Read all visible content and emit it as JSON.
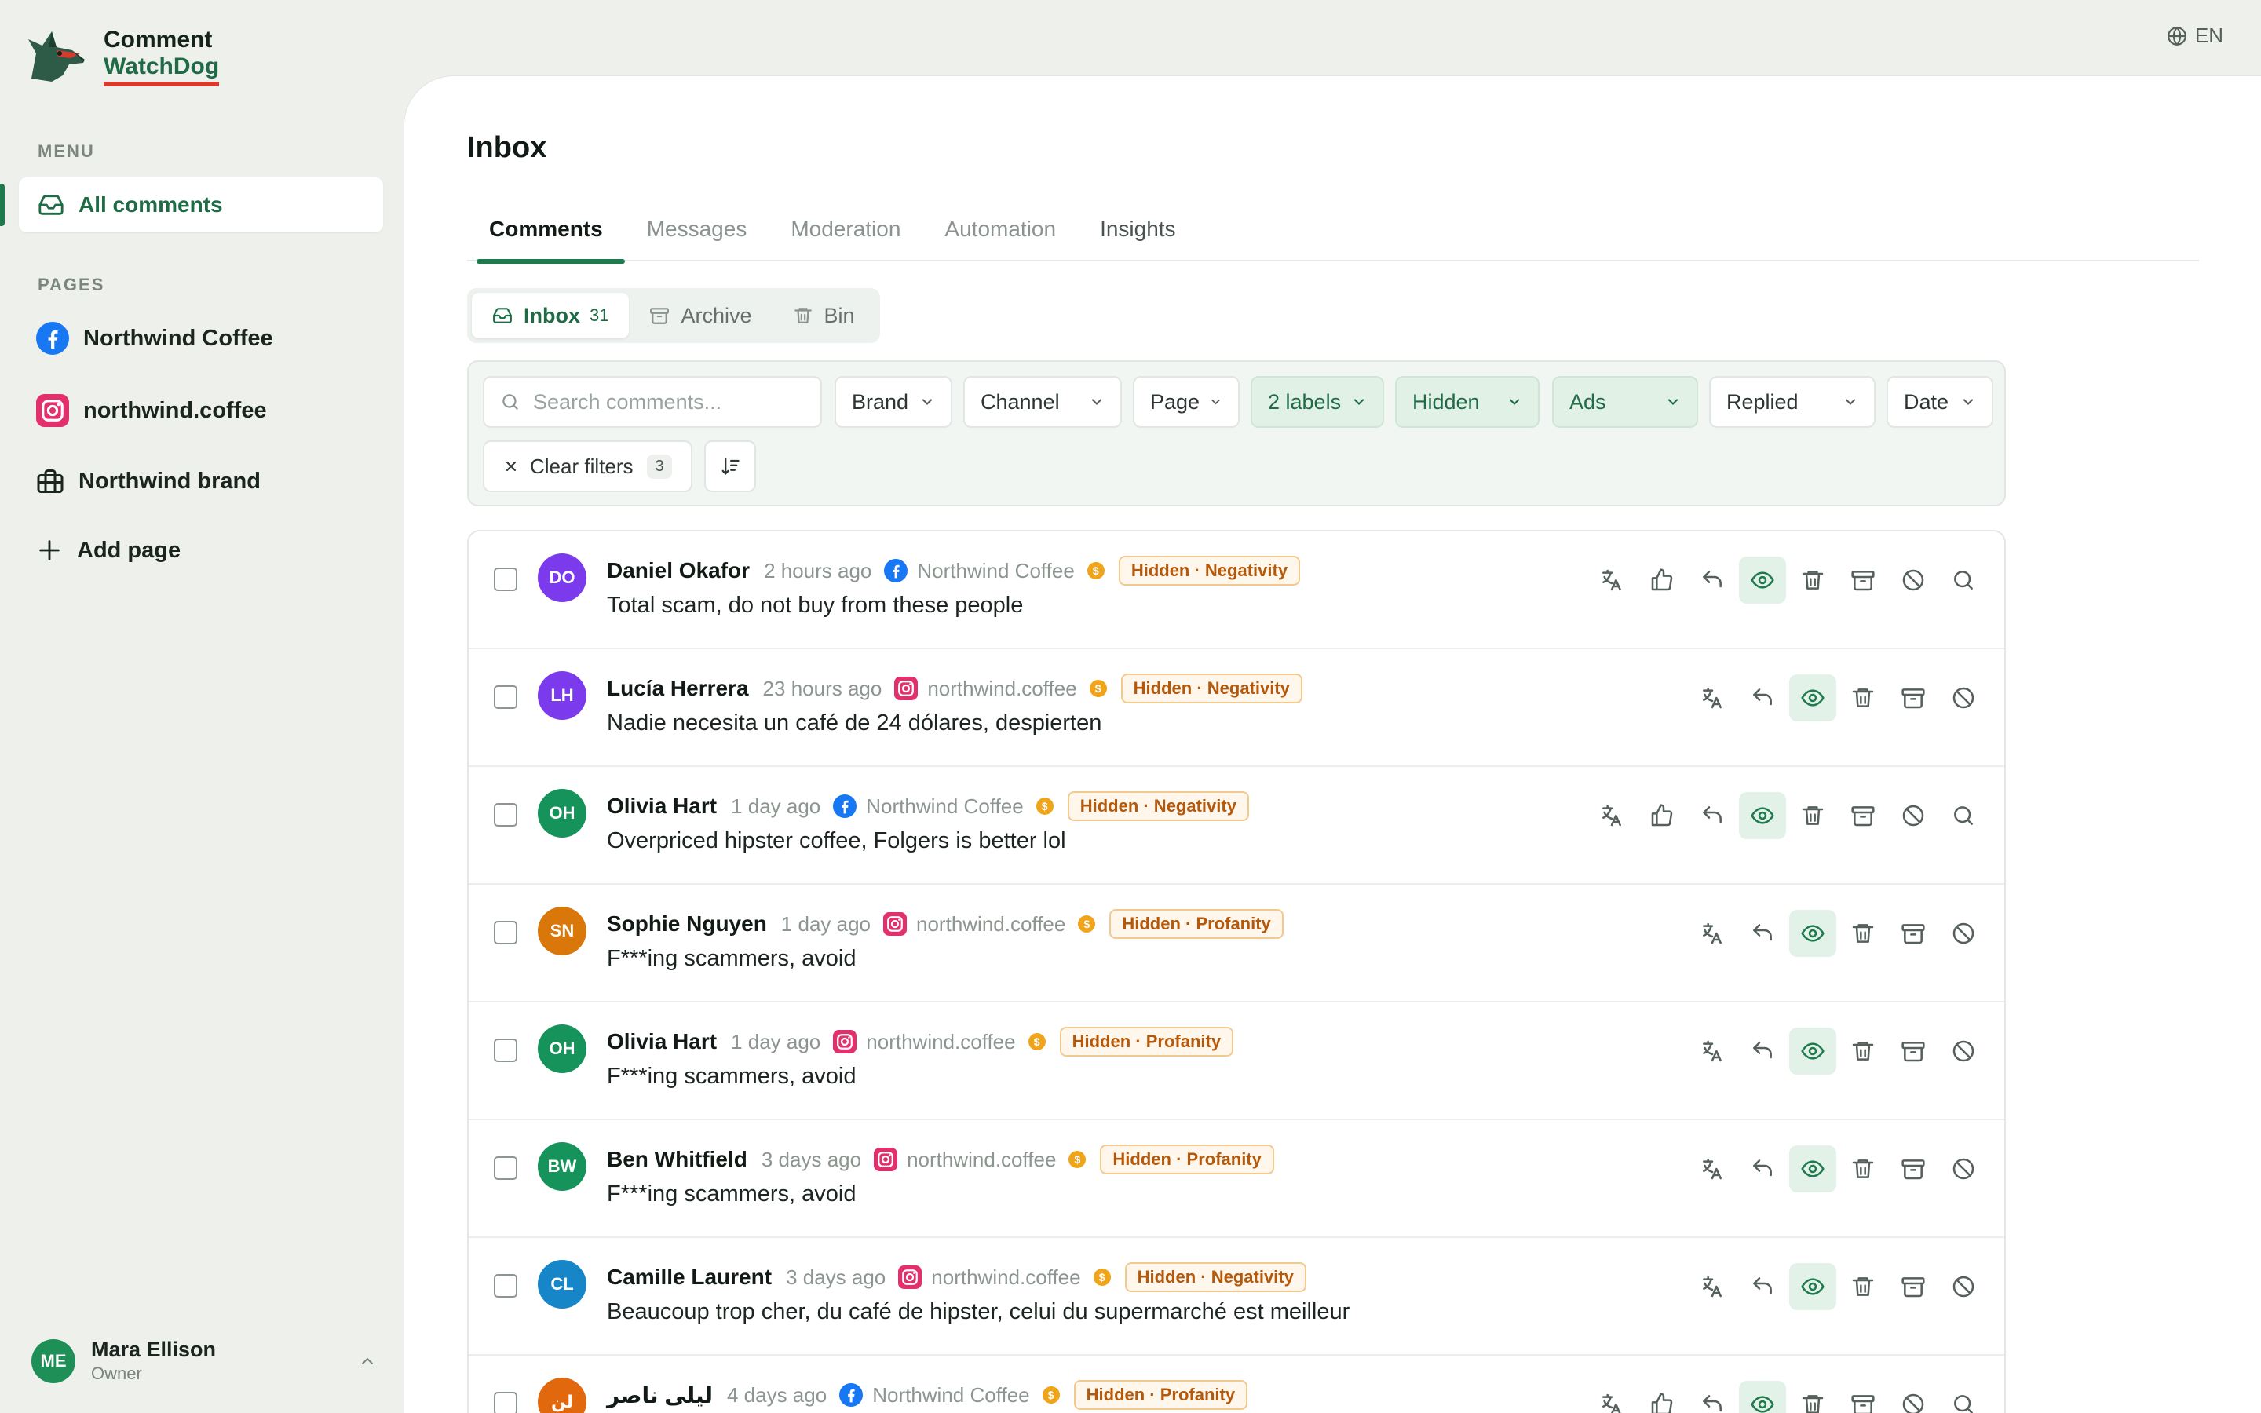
{
  "app": {
    "name_line1": "Comment",
    "name_line2": "WatchDog",
    "language": "EN"
  },
  "sidebar": {
    "menu_label": "MENU",
    "menu_items": [
      {
        "label": "All comments",
        "icon": "inbox-icon"
      }
    ],
    "pages_label": "PAGES",
    "pages": [
      {
        "label": "Northwind Coffee",
        "icon": "facebook-icon"
      },
      {
        "label": "northwind.coffee",
        "icon": "instagram-icon"
      },
      {
        "label": "Northwind brand",
        "icon": "briefcase-icon"
      }
    ],
    "add_page_label": "Add page",
    "user": {
      "initials": "ME",
      "name": "Mara Ellison",
      "role": "Owner"
    }
  },
  "main": {
    "title": "Inbox",
    "tabs": [
      "Comments",
      "Messages",
      "Moderation",
      "Automation",
      "Insights"
    ],
    "segments": [
      {
        "label": "Inbox",
        "count": "31"
      },
      {
        "label": "Archive"
      },
      {
        "label": "Bin"
      }
    ],
    "filters": {
      "search_placeholder": "Search comments...",
      "dropdowns": [
        "Brand",
        "Channel",
        "Page",
        "2 labels",
        "Hidden",
        "Ads",
        "Replied",
        "Date"
      ],
      "clear_label": "Clear filters",
      "clear_count": "3"
    }
  },
  "colors": {
    "accent": "#1f7a4d",
    "tag_text": "#b4590b",
    "facebook": "#1877f2",
    "instagram": "#e1306c"
  },
  "comments": [
    {
      "initials": "DO",
      "author": "Daniel Okafor",
      "time": "2 hours ago",
      "source": "facebook",
      "page": "Northwind Coffee",
      "tag": "Hidden · Negativity",
      "text": "Total scam, do not buy from these people",
      "color": "#7c3aed"
    },
    {
      "initials": "LH",
      "author": "Lucía Herrera",
      "time": "23 hours ago",
      "source": "instagram",
      "page": "northwind.coffee",
      "tag": "Hidden · Negativity",
      "text": "Nadie necesita un café de 24 dólares, despierten",
      "color": "#7c3aed"
    },
    {
      "initials": "OH",
      "author": "Olivia Hart",
      "time": "1 day ago",
      "source": "facebook",
      "page": "Northwind Coffee",
      "tag": "Hidden · Negativity",
      "text": "Overpriced hipster coffee, Folgers is better lol",
      "color": "#16935a"
    },
    {
      "initials": "SN",
      "author": "Sophie Nguyen",
      "time": "1 day ago",
      "source": "instagram",
      "page": "northwind.coffee",
      "tag": "Hidden · Profanity",
      "text": "F***ing scammers, avoid",
      "color": "#d9770a"
    },
    {
      "initials": "OH",
      "author": "Olivia Hart",
      "time": "1 day ago",
      "source": "instagram",
      "page": "northwind.coffee",
      "tag": "Hidden · Profanity",
      "text": "F***ing scammers, avoid",
      "color": "#16935a"
    },
    {
      "initials": "BW",
      "author": "Ben Whitfield",
      "time": "3 days ago",
      "source": "instagram",
      "page": "northwind.coffee",
      "tag": "Hidden · Profanity",
      "text": "F***ing scammers, avoid",
      "color": "#16935a"
    },
    {
      "initials": "CL",
      "author": "Camille Laurent",
      "time": "3 days ago",
      "source": "instagram",
      "page": "northwind.coffee",
      "tag": "Hidden · Negativity",
      "text": "Beaucoup trop cher, du café de hipster, celui du supermarché est meilleur",
      "color": "#1786c9"
    },
    {
      "initials": "لن",
      "author": "ليلى ناصر",
      "time": "4 days ago",
      "source": "facebook",
      "page": "Northwind Coffee",
      "tag": "Hidden · Profanity",
      "text": "",
      "color": "#e2680e"
    }
  ]
}
